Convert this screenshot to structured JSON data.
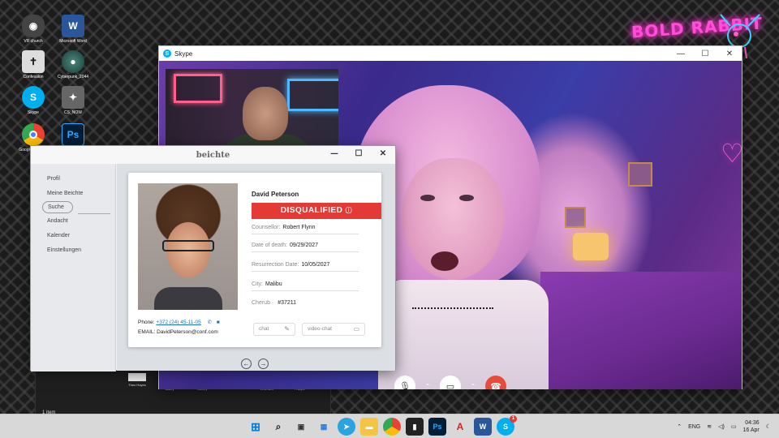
{
  "desktop": {
    "icons": [
      {
        "label": "VR church",
        "icon": "vr-headset-icon"
      },
      {
        "label": "Microsoft Word",
        "icon": "word-icon"
      },
      {
        "label": "Confession",
        "icon": "cross-icon"
      },
      {
        "label": "Cyberpunk_2044",
        "icon": "cyberpunk-icon"
      },
      {
        "label": "Skype",
        "icon": "skype-icon"
      },
      {
        "label": "CS_NOW",
        "icon": "cs-icon"
      },
      {
        "label": "Google Chrome",
        "icon": "chrome-icon"
      },
      {
        "label": "Ps",
        "icon": "photoshop-icon"
      }
    ],
    "neon_sign": "BOLD RABBIT"
  },
  "skype": {
    "title": "Skype",
    "controls": {
      "minimize": "—",
      "maximize": "☐",
      "close": "✕"
    }
  },
  "beichte": {
    "title": "beichte",
    "controls": {
      "minimize": "—",
      "maximize": "☐",
      "close": "✕"
    },
    "sidebar": [
      "Profil",
      "Meine Beichte",
      "Suche",
      "Andacht",
      "Kalender",
      "Einstellungen"
    ],
    "selected": "Suche",
    "profile": {
      "name": "David Peterson",
      "status": "DISQUALIFIED",
      "counsellor_label": "Counsellor:",
      "counsellor": "Robert Flynn",
      "death_label": "Date of death:",
      "death": "09/29/2027",
      "resurrection_label": "Resurrection Date:",
      "resurrection": "10/05/2027",
      "city_label": "City:",
      "city": "Malibu",
      "cherub_label": "Cherub",
      "cherub": "#37211",
      "phone_label": "Phone:",
      "phone": "+372 (24) 45-11-05",
      "email_label": "EMAIL:",
      "email": "DavidPeterson@conf.com",
      "chat_label": "chat",
      "video_label": "video-chat"
    }
  },
  "explorer": {
    "contacts": [
      "Theo Hayes",
      "Theodore Bailey",
      "Thomas Harvey",
      "Toby Powell",
      "Tommy Levinson",
      "Tommy Phillips"
    ],
    "status": "1 item"
  },
  "taskbar": {
    "language": "ENG",
    "time": "04:36",
    "date": "16 Apr",
    "skype_badge": "1"
  }
}
